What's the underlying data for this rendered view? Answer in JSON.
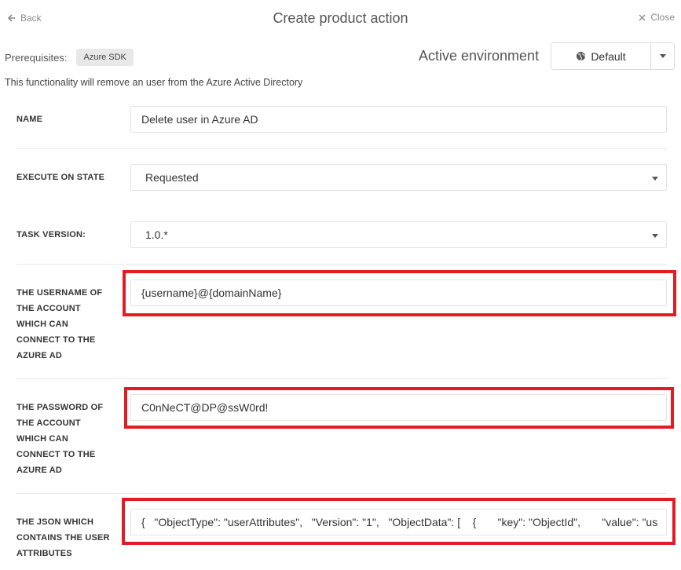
{
  "header": {
    "back_label": "Back",
    "title": "Create product action",
    "close_label": "Close"
  },
  "prerequisites": {
    "label": "Prerequisites:",
    "badge": "Azure SDK"
  },
  "environment": {
    "label": "Active environment",
    "selected": "Default"
  },
  "description": "This functionality will remove an user from the Azure Active Directory",
  "form": {
    "name": {
      "label": "NAME",
      "value": "Delete user in Azure AD"
    },
    "execute_on_state": {
      "label": "EXECUTE ON STATE",
      "value": "Requested"
    },
    "task_version": {
      "label": "TASK VERSION:",
      "value": "1.0.*"
    },
    "username": {
      "label_lines": [
        "THE USERNAME OF",
        "THE ACCOUNT",
        "WHICH CAN",
        "CONNECT TO THE",
        "AZURE AD"
      ],
      "value": "{username}@{domainName}"
    },
    "password": {
      "label_lines": [
        "THE PASSWORD OF",
        "THE ACCOUNT",
        "WHICH CAN",
        "CONNECT TO THE",
        "AZURE AD"
      ],
      "value": "C0nNeCT@DP@ssW0rd!"
    },
    "json": {
      "label_lines": [
        "THE JSON WHICH",
        "CONTAINS THE USER",
        "ATTRIBUTES"
      ],
      "value": "{   \"ObjectType\": \"userAttributes\",   \"Version\": \"1\",   \"ObjectData\": [    {       \"key\": \"ObjectId\",       \"value\": \"us"
    }
  },
  "colors": {
    "highlight": "#e31b23"
  },
  "icons": {
    "back": "arrow-left-icon",
    "close": "x-icon",
    "environment": "globe-icon",
    "dropdown": "caret-down-icon"
  }
}
